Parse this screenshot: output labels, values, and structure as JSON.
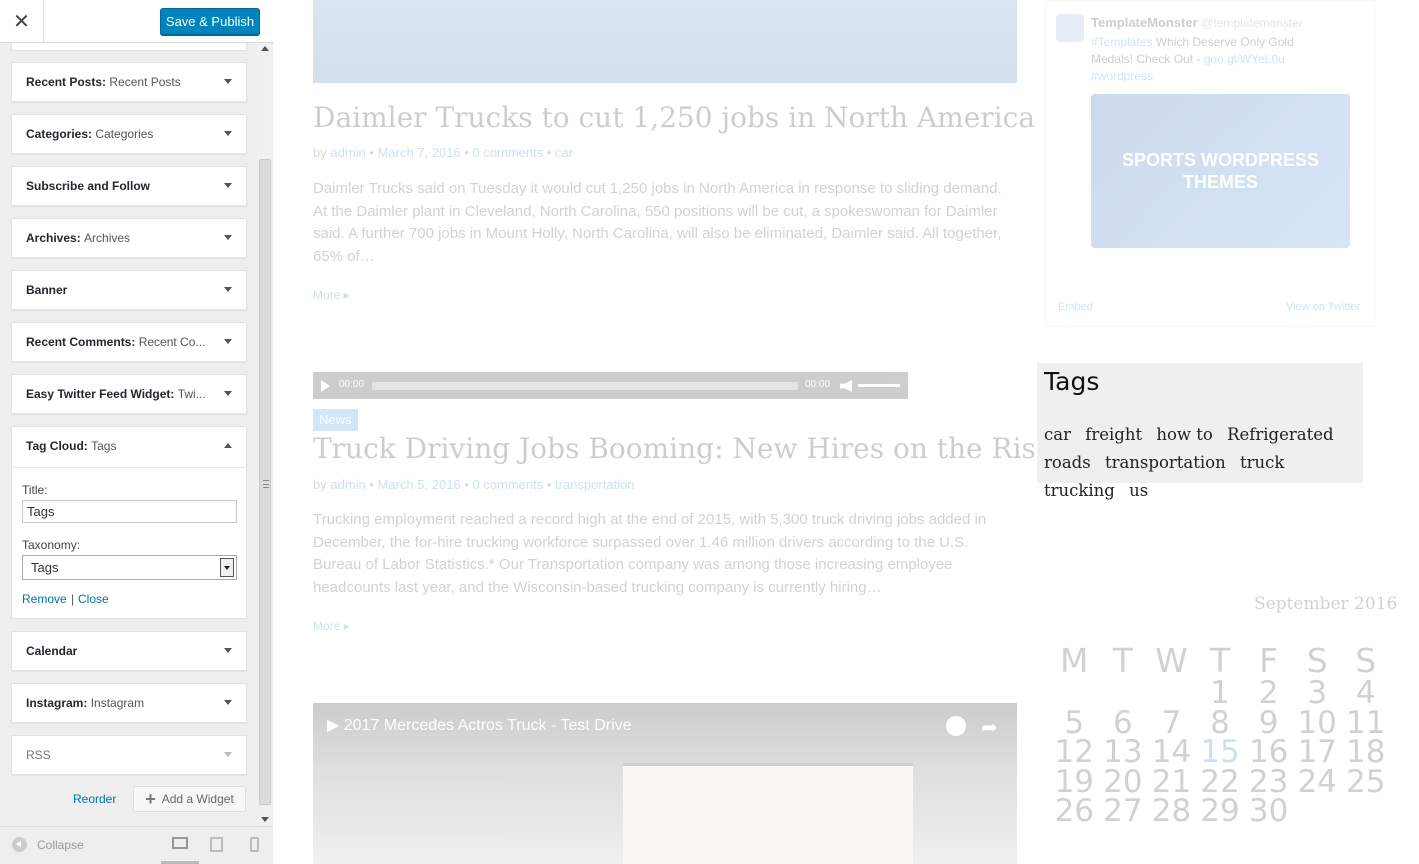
{
  "panel": {
    "close_icon": "close-icon",
    "publish_label": "Save & Publish",
    "widgets": [
      {
        "title": "Recent Posts:",
        "sub": "Recent Posts"
      },
      {
        "title": "Categories:",
        "sub": "Categories"
      },
      {
        "title": "Subscribe and Follow",
        "sub": ""
      },
      {
        "title": "Archives:",
        "sub": "Archives"
      },
      {
        "title": "Banner",
        "sub": ""
      },
      {
        "title": "Recent Comments:",
        "sub": "Recent Co..."
      },
      {
        "title": "Easy Twitter Feed Widget:",
        "sub": "Twi..."
      },
      {
        "title": "Tag Cloud:",
        "sub": "Tags"
      },
      {
        "title": "Calendar",
        "sub": ""
      },
      {
        "title": "Instagram:",
        "sub": "Instagram"
      },
      {
        "title": "RSS",
        "sub": ""
      }
    ],
    "tag_cloud_form": {
      "title_label": "Title:",
      "title_value": "Tags",
      "taxonomy_label": "Taxonomy:",
      "taxonomy_value": "Tags",
      "remove_label": "Remove",
      "separator": "|",
      "close_label": "Close"
    },
    "reorder_label": "Reorder",
    "add_widget_label": "Add a Widget",
    "collapse_label": "Collapse"
  },
  "preview": {
    "post1": {
      "title": "Daimler Trucks to cut 1,250 jobs in North America",
      "by": "by",
      "author": "admin",
      "date": "March 7, 2016",
      "comments": "0 comments",
      "category": "car",
      "excerpt": "Daimler Trucks said on Tuesday it would cut 1,250 jobs in North America in response to sliding demand. At the Daimler plant in Cleveland, North Carolina, 550 positions will be cut, a spokeswoman for Daimler said. A further 700 jobs in Mount Holly, North Carolina, will also be eliminated, Daimler said. All together, 65% of…",
      "more": "More"
    },
    "audio": {
      "time_start": "00:00",
      "time_end": "00:00"
    },
    "post2": {
      "badge": "News",
      "title": "Truck Driving Jobs Booming: New Hires on the Rise",
      "by": "by",
      "author": "admin",
      "date": "March 5, 2016",
      "comments": "0 comments",
      "category": "transportation",
      "excerpt": "Trucking employment reached a record high at the end of 2015, with 5,300 truck driving jobs added in December, the for-hire trucking workforce surpassed over 1.46 million drivers according to the U.S. Bureau of Labor Statistics.* Our Transportation company was among those increasing employee headcounts last year, and the Wisconsin-based trucking company is currently hiring…",
      "more": "More"
    },
    "video": {
      "title": "2017 Mercedes Actros Truck - Test Drive"
    },
    "twitter": {
      "name": "TemplateMonster",
      "handle": "@templatemonster",
      "hashtag": "#Templates",
      "text": "Which Deserve Only Gold Medals! Check Out -",
      "link": "goo.gl/WYeL0u",
      "hashtag2": "#wordpress",
      "image_text": "SPORTS WORDPRESS THEMES",
      "embed": "Embed",
      "view": "View on Twitter"
    },
    "tags_widget": {
      "title": "Tags",
      "tags": [
        "car",
        "freight",
        "how to",
        "Refrigerated",
        "roads",
        "transportation",
        "truck",
        "trucking",
        "us"
      ]
    },
    "calendar": {
      "caption": "September 2016",
      "days": [
        "M",
        "T",
        "W",
        "T",
        "F",
        "S",
        "S"
      ],
      "weeks": [
        [
          "",
          "",
          "",
          "1",
          "2",
          "3",
          "4"
        ],
        [
          "5",
          "6",
          "7",
          "8",
          "9",
          "10",
          "11"
        ],
        [
          "12",
          "13",
          "14",
          "15",
          "16",
          "17",
          "18"
        ],
        [
          "19",
          "20",
          "21",
          "22",
          "23",
          "24",
          "25"
        ],
        [
          "26",
          "27",
          "28",
          "29",
          "30",
          "",
          ""
        ]
      ],
      "today": "15"
    }
  }
}
